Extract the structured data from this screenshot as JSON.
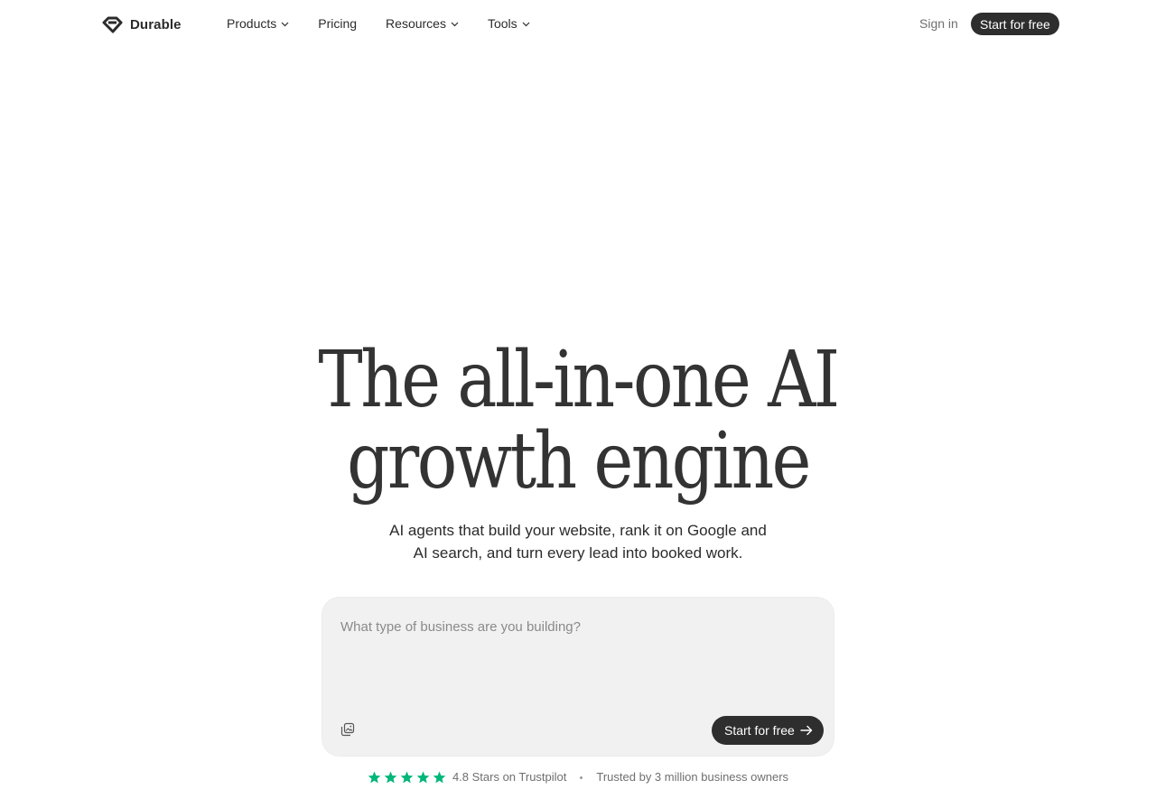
{
  "brand": {
    "name": "Durable"
  },
  "nav": {
    "items": [
      {
        "label": "Products",
        "has_dropdown": true
      },
      {
        "label": "Pricing",
        "has_dropdown": false
      },
      {
        "label": "Resources",
        "has_dropdown": true
      },
      {
        "label": "Tools",
        "has_dropdown": true
      }
    ],
    "sign_in": "Sign in",
    "cta": "Start for free"
  },
  "hero": {
    "headline_line1": "The all-in-one AI",
    "headline_line2": "growth engine",
    "subhead_line1": "AI agents that build your website, rank it on Google and",
    "subhead_line2": "AI search, and turn every lead into booked work."
  },
  "prompt": {
    "placeholder": "What type of business are you building?",
    "value": "",
    "cta": "Start for free",
    "attach_icon": "image-stack-icon",
    "cta_icon": "arrow-right-icon"
  },
  "trust": {
    "rating_stars": 5,
    "rating_text": "4.8 Stars on Trustpilot",
    "users_text": "Trusted by 3 million business owners"
  },
  "colors": {
    "text": "#2b2b2b",
    "muted": "#6f6f6f",
    "button_bg": "#2e2e2e",
    "button_text": "#ffffff",
    "prompt_bg": "#f1f1f1",
    "star": "#00b67a"
  }
}
